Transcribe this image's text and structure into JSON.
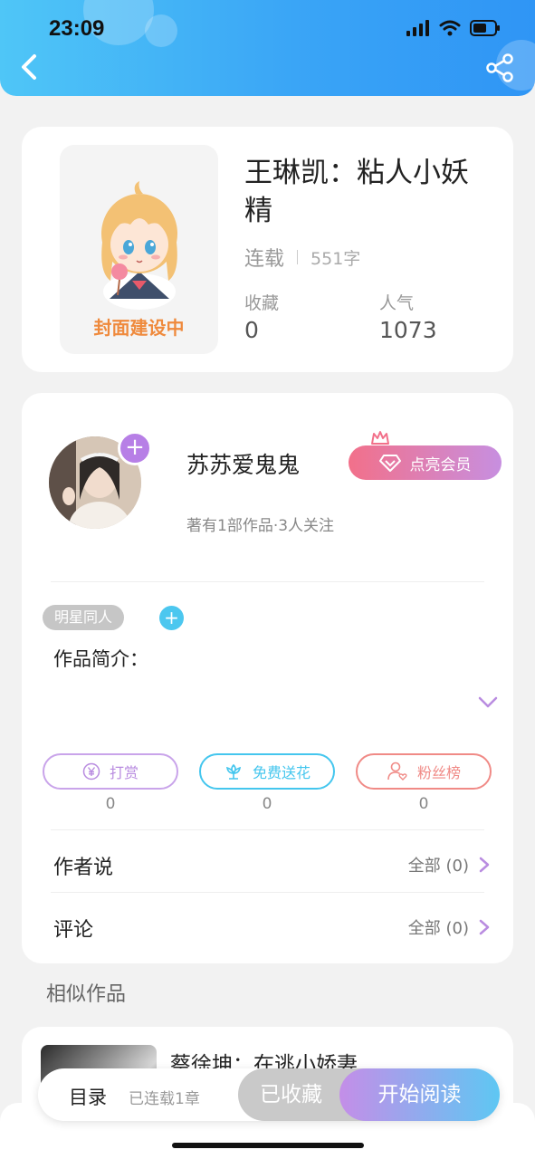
{
  "status_bar": {
    "time": "23:09",
    "icons": [
      "signal-icon",
      "wifi-icon",
      "battery-icon"
    ]
  },
  "nav": {
    "back_icon": "chevron-left-icon",
    "share_icon": "share-icon"
  },
  "book": {
    "cover_text": "封面建设中",
    "title": "王琳凯：粘人小妖精",
    "status": "连载",
    "word_count": "551字",
    "favorites_label": "收藏",
    "favorites_value": "0",
    "popularity_label": "人气",
    "popularity_value": "1073"
  },
  "author": {
    "name": "苏苏爱鬼鬼",
    "meta": "著有1部作品·3人关注",
    "vip_button": "点亮会员",
    "follow_icon": "plus-icon"
  },
  "tags": {
    "items": [
      "明星同人"
    ],
    "add_icon": "plus-icon"
  },
  "intro": {
    "label": "作品简介：",
    "expand_icon": "chevron-down-icon"
  },
  "actions": [
    {
      "label": "打赏",
      "count": "0",
      "icon": "yen-coin-icon",
      "color": "#b98ce0"
    },
    {
      "label": "免费送花",
      "count": "0",
      "icon": "flower-icon",
      "color": "#44c6ee"
    },
    {
      "label": "粉丝榜",
      "count": "0",
      "icon": "fan-heart-icon",
      "color": "#f08a86"
    }
  ],
  "author_says": {
    "label": "作者说",
    "all": "全部 (0)"
  },
  "comments": {
    "label": "评论",
    "all": "全部 (0)"
  },
  "similar": {
    "title": "相似作品",
    "first_book_title": "蔡徐坤：在逃小娇妻"
  },
  "bottom_bar": {
    "toc_label": "目录",
    "toc_sub": "已连载1章",
    "favorited_label": "已收藏",
    "read_label": "开始阅读"
  }
}
